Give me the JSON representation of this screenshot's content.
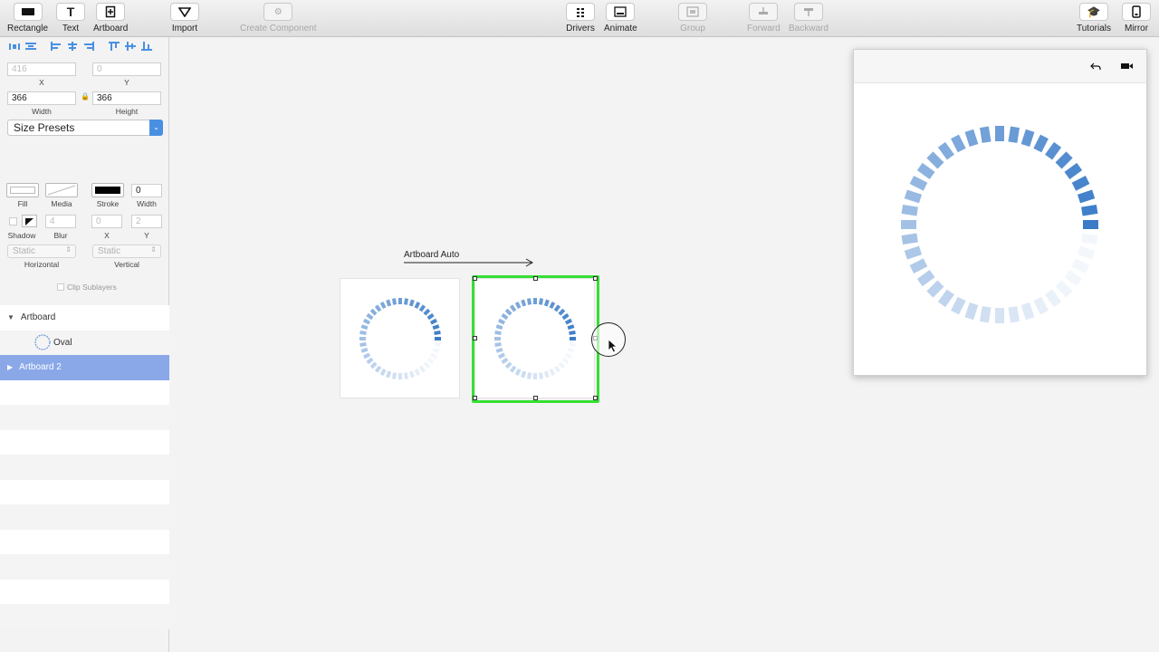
{
  "toolbar": {
    "rectangle": "Rectangle",
    "text": "Text",
    "artboard": "Artboard",
    "import": "Import",
    "create_component": "Create Component",
    "drivers": "Drivers",
    "animate": "Animate",
    "group": "Group",
    "forward": "Forward",
    "backward": "Backward",
    "tutorials": "Tutorials",
    "mirror": "Mirror"
  },
  "inspector": {
    "x_value": "416",
    "y_value": "0",
    "x_label": "X",
    "y_label": "Y",
    "width_value": "366",
    "height_value": "366",
    "width_label": "Width",
    "height_label": "Height",
    "size_presets": "Size Presets",
    "fill_label": "Fill",
    "media_label": "Media",
    "stroke_label": "Stroke",
    "stroke_width_value": "0",
    "stroke_width_label": "Width",
    "shadow_label": "Shadow",
    "blur_value": "4",
    "blur_label": "Blur",
    "shadow_x_value": "0",
    "shadow_y_value": "2",
    "shadow_x_label": "X",
    "shadow_y_label": "Y",
    "horizontal_value": "Static",
    "vertical_value": "Static",
    "horizontal_label": "Horizontal",
    "vertical_label": "Vertical",
    "clip_sublayers": "Clip Sublayers"
  },
  "layers": {
    "items": [
      {
        "label": "Artboard"
      },
      {
        "label": "Oval"
      },
      {
        "label": "Artboard 2"
      }
    ]
  },
  "canvas": {
    "transition_label": "Artboard Auto"
  },
  "colors": {
    "accent": "#4a90e2",
    "selection": "#35e035",
    "layer_selected": "#8aa8e8",
    "ring": "#3a7bc8"
  },
  "icons": {
    "undo": "undo-icon",
    "record": "video-camera-icon"
  }
}
